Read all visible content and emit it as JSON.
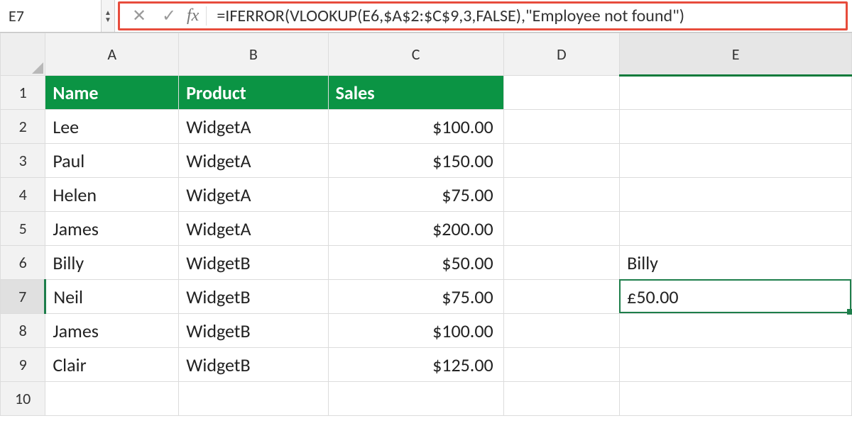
{
  "name_box": "E7",
  "formula_bar": {
    "cancel_label": "✕",
    "confirm_label": "✓",
    "fx_label": "fx",
    "formula": "=IFERROR(VLOOKUP(E6,$A$2:$C$9,3,FALSE),\"Employee not found\")"
  },
  "columns": [
    "A",
    "B",
    "C",
    "D",
    "E"
  ],
  "row_numbers": [
    "1",
    "2",
    "3",
    "4",
    "5",
    "6",
    "7",
    "8",
    "9",
    "10"
  ],
  "headers": {
    "A": "Name",
    "B": "Product",
    "C": "Sales"
  },
  "rows": [
    {
      "A": "Lee",
      "B": "WidgetA",
      "C": "$100.00"
    },
    {
      "A": "Paul",
      "B": "WidgetA",
      "C": "$150.00"
    },
    {
      "A": "Helen",
      "B": "WidgetA",
      "C": "$75.00"
    },
    {
      "A": "James",
      "B": "WidgetA",
      "C": "$200.00"
    },
    {
      "A": "Billy",
      "B": "WidgetB",
      "C": "$50.00"
    },
    {
      "A": "Neil",
      "B": "WidgetB",
      "C": "$75.00"
    },
    {
      "A": "James",
      "B": "WidgetB",
      "C": "$100.00"
    },
    {
      "A": "Clair",
      "B": "WidgetB",
      "C": "$125.00"
    }
  ],
  "lookup": {
    "E6": "Billy",
    "E7": "£50.00"
  },
  "active_cell": "E7",
  "colors": {
    "header_bg": "#0b9444",
    "highlight": "#e74c3c",
    "selection": "#1e7e4b"
  }
}
